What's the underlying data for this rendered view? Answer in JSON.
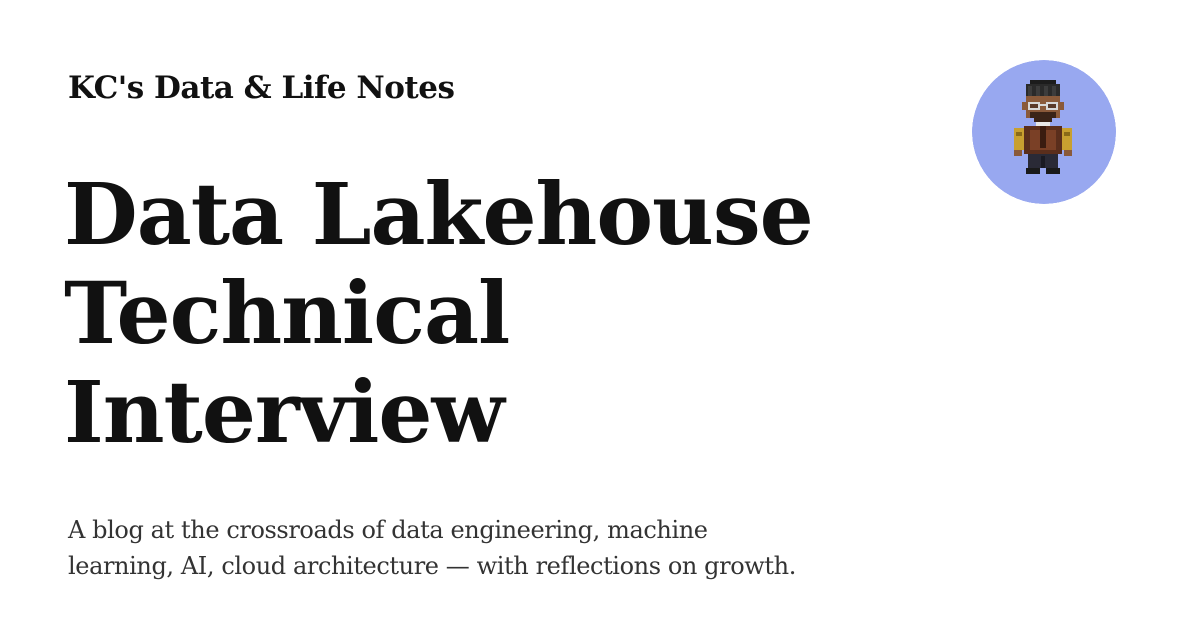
{
  "site": {
    "name": "KC's Data & Life Notes"
  },
  "post": {
    "title_lines": [
      "Data Lakehouse",
      "Technical",
      "Interview"
    ]
  },
  "tagline": {
    "line1": "A blog at the crossroads of data engineering, machine",
    "line2": "learning, AI, cloud architecture — with reflections on growth."
  },
  "avatar": {
    "icon": "pixel-art-person-icon",
    "background_color": "#98a8f0"
  },
  "colors": {
    "background": "#ffffff",
    "text": "#111111",
    "muted_text": "#333333"
  }
}
